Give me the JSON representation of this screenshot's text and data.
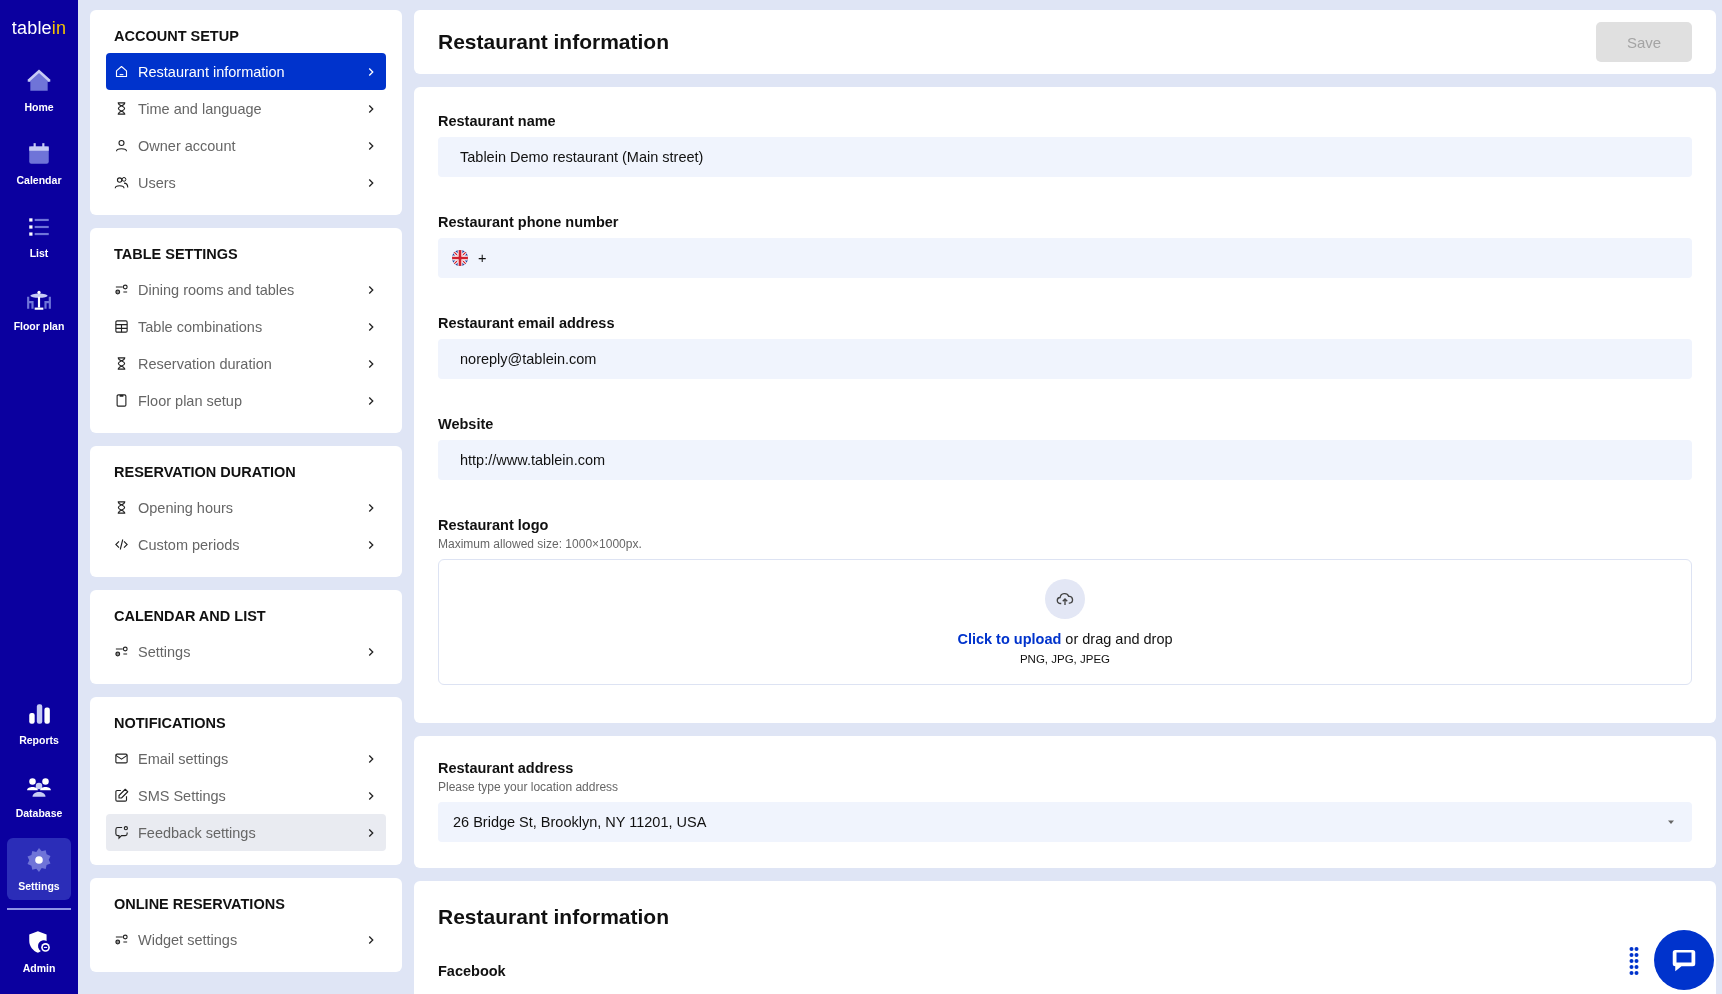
{
  "logo": {
    "text": "table",
    "accent": "in"
  },
  "nav": {
    "main": [
      {
        "label": "Home",
        "selected": false
      },
      {
        "label": "Calendar",
        "selected": false
      },
      {
        "label": "List",
        "selected": false
      },
      {
        "label": "Floor plan",
        "selected": false
      }
    ],
    "tools": [
      {
        "label": "Reports",
        "selected": false
      },
      {
        "label": "Database",
        "selected": false
      },
      {
        "label": "Settings",
        "selected": true
      }
    ],
    "admin": [
      {
        "label": "Admin",
        "selected": false
      }
    ]
  },
  "settings_menu": [
    {
      "title": "ACCOUNT SETUP",
      "items": [
        {
          "label": "Restaurant information",
          "selected": true,
          "hovered": false
        },
        {
          "label": "Time and language",
          "selected": false,
          "hovered": false
        },
        {
          "label": "Owner account",
          "selected": false,
          "hovered": false
        },
        {
          "label": "Users",
          "selected": false,
          "hovered": false
        }
      ]
    },
    {
      "title": "TABLE SETTINGS",
      "items": [
        {
          "label": "Dining rooms and tables",
          "selected": false,
          "hovered": false
        },
        {
          "label": "Table combinations",
          "selected": false,
          "hovered": false
        },
        {
          "label": "Reservation duration",
          "selected": false,
          "hovered": false
        },
        {
          "label": "Floor plan setup",
          "selected": false,
          "hovered": false
        }
      ]
    },
    {
      "title": "RESERVATION DURATION",
      "items": [
        {
          "label": "Opening hours",
          "selected": false,
          "hovered": false
        },
        {
          "label": "Custom periods",
          "selected": false,
          "hovered": false
        }
      ]
    },
    {
      "title": "CALENDAR AND LIST",
      "items": [
        {
          "label": "Settings",
          "selected": false,
          "hovered": false
        }
      ]
    },
    {
      "title": "NOTIFICATIONS",
      "items": [
        {
          "label": "Email settings",
          "selected": false,
          "hovered": false
        },
        {
          "label": "SMS Settings",
          "selected": false,
          "hovered": false
        },
        {
          "label": "Feedback settings",
          "selected": false,
          "hovered": true
        }
      ]
    },
    {
      "title": "ONLINE RESERVATIONS",
      "items": [
        {
          "label": "Widget settings",
          "selected": false,
          "hovered": false
        }
      ]
    }
  ],
  "header": {
    "title": "Restaurant information",
    "save_button": {
      "label": "Save",
      "disabled": true
    }
  },
  "form": [
    {
      "kind": "text",
      "label": "Restaurant name",
      "value": "Tablein Demo restaurant (Main street)"
    },
    {
      "kind": "phone",
      "label": "Restaurant phone number",
      "value": "+"
    },
    {
      "kind": "text",
      "label": "Restaurant email address",
      "value": "noreply@tablein.com"
    },
    {
      "kind": "text",
      "label": "Website",
      "value": "http://www.tablein.com"
    },
    {
      "kind": "upload",
      "label": "Restaurant logo",
      "hint": "Maximum allowed size: 1000×1000px.",
      "link": "Click to upload",
      "text": "or drag and drop",
      "formats": "PNG, JPG, JPEG"
    }
  ],
  "address": {
    "label": "Restaurant address",
    "hint": "Please type your location address",
    "value": "26 Bridge St, Brooklyn, NY 11201, USA"
  },
  "social": {
    "title": "Restaurant information",
    "field_label": "Facebook"
  }
}
